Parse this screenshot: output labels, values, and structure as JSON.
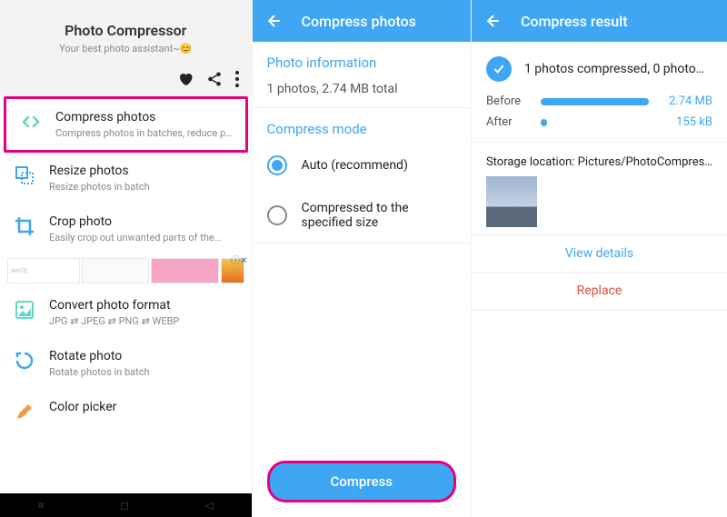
{
  "col1": {
    "title": "Photo Compressor",
    "subtitle": "Your best photo assistant~😊",
    "items": [
      {
        "label": "Compress photos",
        "desc": "Compress photos in batches, reduce p…"
      },
      {
        "label": "Resize photos",
        "desc": "Resize photos in batch"
      },
      {
        "label": "Crop photo",
        "desc": "Easily crop out unwanted parts of the…"
      },
      {
        "label": "Convert photo format",
        "desc": "JPG ⇄ JPEG ⇄ PNG ⇄ WEBP"
      },
      {
        "label": "Rotate photo",
        "desc": "Rotate photos in batch"
      },
      {
        "label": "Color picker",
        "desc": ""
      }
    ],
    "ad_white_label": "WHITE"
  },
  "col2": {
    "appbar": "Compress photos",
    "section1": "Photo information",
    "info": "1 photos, 2.74 MB total",
    "section2": "Compress mode",
    "opt1": "Auto (recommend)",
    "opt2": "Compressed to the specified size",
    "button": "Compress"
  },
  "col3": {
    "appbar": "Compress result",
    "result": "1 photos compressed, 0 photo…",
    "before_label": "Before",
    "before_val": "2.74 MB",
    "after_label": "After",
    "after_val": "155 kB",
    "storage": "Storage location: Pictures/PhotoCompres…",
    "view": "View details",
    "replace": "Replace"
  }
}
